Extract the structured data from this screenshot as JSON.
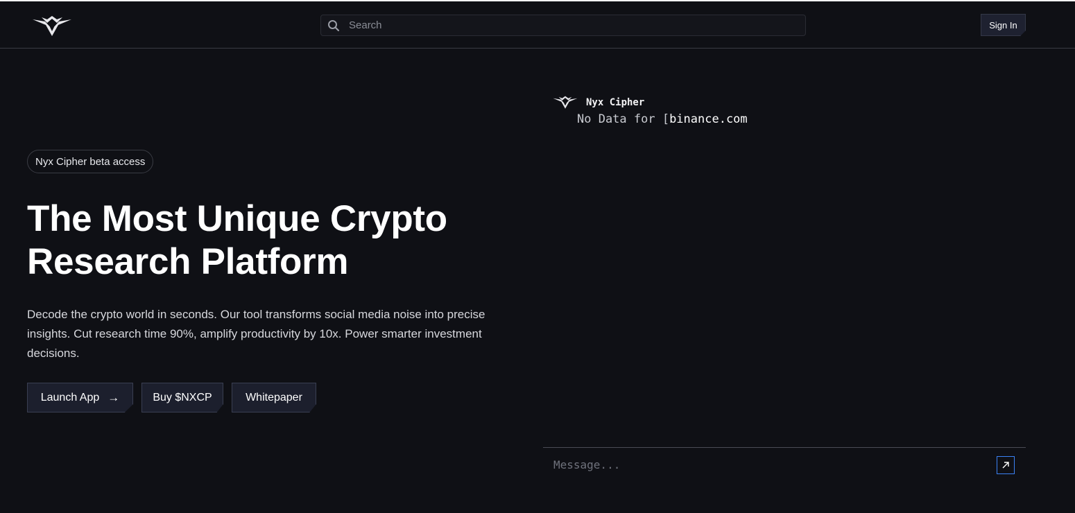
{
  "header": {
    "logo": "nyx-cipher-logo",
    "search": {
      "placeholder": "Search",
      "icon": "search-icon"
    },
    "signin_label": "Sign In"
  },
  "hero": {
    "badge": "Nyx Cipher beta access",
    "title_line1": "The Most Unique Crypto",
    "title_line2": "Research Platform",
    "description": "Decode the crypto world in seconds. Our tool transforms social media noise into precise insights. Cut research time 90%, amplify productivity by 10x. Power smarter investment decisions.",
    "buttons": {
      "launch_label": "Launch App",
      "launch_icon": "→",
      "buy_label": "Buy $NXCP",
      "whitepaper_label": "Whitepaper"
    }
  },
  "chat": {
    "bot_name": "Nyx Cipher",
    "message_prefix": "No Data for [",
    "message_highlight": "binance.com",
    "input_placeholder": "Message...",
    "send_icon": "arrow-up-right-icon"
  },
  "colors": {
    "background": "#0f1015",
    "button_bg": "#1c1f2d",
    "send_border": "#3b82f6"
  }
}
